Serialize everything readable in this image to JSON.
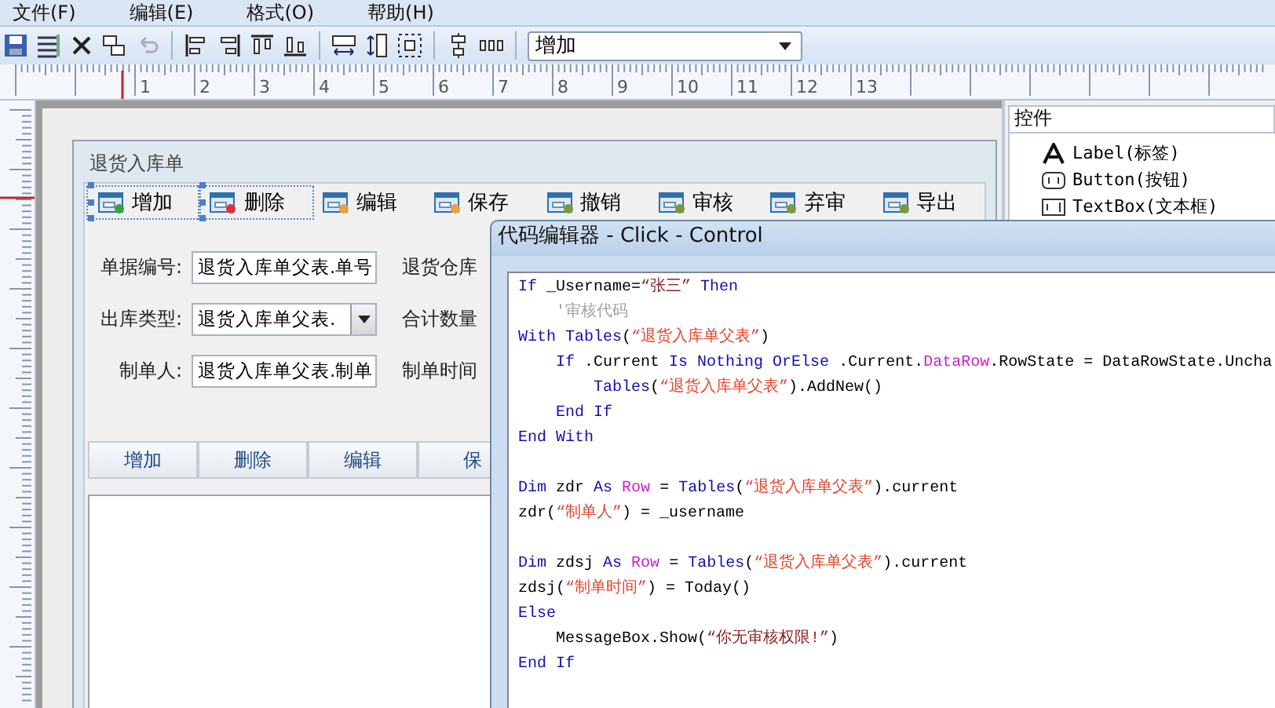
{
  "menu": [
    {
      "label": "文件(F)"
    },
    {
      "label": "编辑(E)"
    },
    {
      "label": "格式(O)"
    },
    {
      "label": "帮助(H)"
    }
  ],
  "toolbar": {
    "dropdown": {
      "value": "增加"
    }
  },
  "ruler": {
    "labels": [
      "1",
      "2",
      "3",
      "4",
      "5",
      "6",
      "7",
      "8",
      "9",
      "10",
      "11",
      "12",
      "13"
    ]
  },
  "form_window": {
    "title": "退货入库单",
    "buttons": [
      {
        "label": "增加",
        "selected": true
      },
      {
        "label": "删除",
        "selected": true
      },
      {
        "label": "编辑",
        "selected": false
      },
      {
        "label": "保存",
        "selected": false
      },
      {
        "label": "撤销",
        "selected": false
      },
      {
        "label": "审核",
        "selected": false
      },
      {
        "label": "弃审",
        "selected": false
      },
      {
        "label": "导出",
        "selected": false
      }
    ],
    "fields": [
      {
        "label": "单据编号:",
        "kind": "text",
        "value": "退货入库单父表.单号",
        "next_label": "退货仓库"
      },
      {
        "label": "出库类型:",
        "kind": "combo",
        "value": "退货入库单父表.",
        "next_label": "合计数量"
      },
      {
        "label": "制单人:",
        "kind": "text",
        "value": "退货入库单父表.制单",
        "next_label": "制单时间"
      }
    ],
    "tabs": [
      {
        "label": "增加"
      },
      {
        "label": "删除"
      },
      {
        "label": "编辑"
      },
      {
        "label": "保"
      }
    ]
  },
  "controls_panel": {
    "title": "控件",
    "items": [
      {
        "label": "Label(标签)"
      },
      {
        "label": "Button(按钮)"
      },
      {
        "label": "TextBox(文本框)"
      }
    ]
  },
  "code_editor": {
    "title": "代码编辑器 - Click - Control",
    "lines": [
      {
        "kind": "code",
        "tokens": [
          {
            "kind": "keyword",
            "text": "If"
          },
          {
            "kind": "plain",
            "text": " _Username="
          },
          {
            "kind": "literal",
            "text": "“张三”"
          },
          {
            "kind": "keyword",
            "text": " Then"
          }
        ]
      },
      {
        "kind": "code",
        "tokens": [
          {
            "kind": "comment",
            "text": "    '审核代码"
          }
        ]
      },
      {
        "kind": "code",
        "tokens": [
          {
            "kind": "keyword",
            "text": "With Tables"
          },
          {
            "kind": "plain",
            "text": "("
          },
          {
            "kind": "string",
            "text": "“退货入库单父表”"
          },
          {
            "kind": "plain",
            "text": ")"
          }
        ]
      },
      {
        "kind": "code",
        "tokens": [
          {
            "kind": "keyword",
            "text": "    If"
          },
          {
            "kind": "plain",
            "text": " .Current "
          },
          {
            "kind": "keyword",
            "text": "Is Nothing OrElse"
          },
          {
            "kind": "plain",
            "text": " .Current."
          },
          {
            "kind": "type",
            "text": "DataRow"
          },
          {
            "kind": "plain",
            "text": ".RowState = DataRowState.Uncha"
          }
        ]
      },
      {
        "kind": "code",
        "tokens": [
          {
            "kind": "keyword",
            "text": "        Tables"
          },
          {
            "kind": "plain",
            "text": "("
          },
          {
            "kind": "string",
            "text": "“退货入库单父表”"
          },
          {
            "kind": "plain",
            "text": ").AddNew()"
          }
        ]
      },
      {
        "kind": "code",
        "tokens": [
          {
            "kind": "keyword",
            "text": "    End If"
          }
        ]
      },
      {
        "kind": "code",
        "tokens": [
          {
            "kind": "keyword",
            "text": "End With"
          }
        ]
      },
      {
        "kind": "blank"
      },
      {
        "kind": "code",
        "tokens": [
          {
            "kind": "keyword",
            "text": "Dim"
          },
          {
            "kind": "plain",
            "text": " zdr "
          },
          {
            "kind": "keyword",
            "text": "As"
          },
          {
            "kind": "type",
            "text": " Row"
          },
          {
            "kind": "plain",
            "text": " = "
          },
          {
            "kind": "keyword",
            "text": "Tables"
          },
          {
            "kind": "plain",
            "text": "("
          },
          {
            "kind": "string",
            "text": "“退货入库单父表”"
          },
          {
            "kind": "plain",
            "text": ").current"
          }
        ]
      },
      {
        "kind": "code",
        "tokens": [
          {
            "kind": "plain",
            "text": "zdr("
          },
          {
            "kind": "string",
            "text": "“制单人”"
          },
          {
            "kind": "plain",
            "text": ") = _username"
          }
        ]
      },
      {
        "kind": "blank"
      },
      {
        "kind": "code",
        "tokens": [
          {
            "kind": "keyword",
            "text": "Dim"
          },
          {
            "kind": "plain",
            "text": " zdsj "
          },
          {
            "kind": "keyword",
            "text": "As"
          },
          {
            "kind": "type",
            "text": " Row"
          },
          {
            "kind": "plain",
            "text": " = "
          },
          {
            "kind": "keyword",
            "text": "Tables"
          },
          {
            "kind": "plain",
            "text": "("
          },
          {
            "kind": "string",
            "text": "“退货入库单父表”"
          },
          {
            "kind": "plain",
            "text": ").current"
          }
        ]
      },
      {
        "kind": "code",
        "tokens": [
          {
            "kind": "plain",
            "text": "zdsj("
          },
          {
            "kind": "string",
            "text": "“制单时间”"
          },
          {
            "kind": "plain",
            "text": ") = Today()"
          }
        ]
      },
      {
        "kind": "code",
        "tokens": [
          {
            "kind": "keyword",
            "text": "Else"
          }
        ]
      },
      {
        "kind": "code",
        "tokens": [
          {
            "kind": "plain",
            "text": "    MessageBox.Show("
          },
          {
            "kind": "literal",
            "text": "“你无审核权限!”"
          },
          {
            "kind": "plain",
            "text": ")"
          }
        ]
      },
      {
        "kind": "code",
        "tokens": [
          {
            "kind": "keyword",
            "text": "End If"
          }
        ]
      }
    ]
  }
}
